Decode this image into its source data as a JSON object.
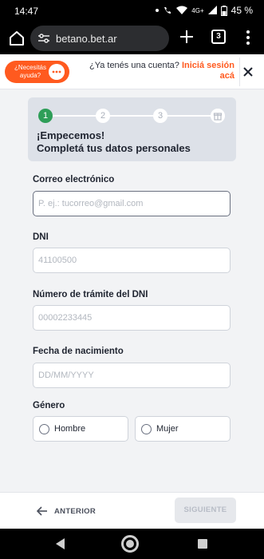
{
  "status_bar": {
    "time": "14:47",
    "network": "4G+",
    "battery": "45 %",
    "icons": [
      "notification-dot-icon",
      "call-wifi-icon",
      "wifi-icon",
      "signal-icon",
      "battery-icon"
    ]
  },
  "browser": {
    "url": "betano.bet.ar",
    "tab_count": "3",
    "icons": [
      "home-icon",
      "site-settings-icon",
      "plus-icon",
      "tabs-icon",
      "overflow-menu-icon"
    ]
  },
  "header": {
    "help_label": "¿Necesitás ayuda?",
    "account_question": "¿Ya tenés una cuenta?",
    "login_link": "Iniciá sesión acá"
  },
  "stepper": {
    "steps": [
      "1",
      "2",
      "3"
    ],
    "current_step": 1,
    "title_line1": "¡Empecemos!",
    "title_line2": "Completá tus datos personales"
  },
  "form": {
    "email": {
      "label": "Correo electrónico",
      "placeholder": "P. ej.: tucorreo@gmail.com",
      "value": ""
    },
    "dni": {
      "label": "DNI",
      "placeholder": "41100500",
      "value": ""
    },
    "tramite": {
      "label": "Número de trámite del DNI",
      "placeholder": "00002233445",
      "value": ""
    },
    "birthdate": {
      "label": "Fecha de nacimiento",
      "placeholder": "DD/MM/YYYY",
      "value": ""
    },
    "gender": {
      "label": "Género",
      "options": [
        "Hombre",
        "Mujer"
      ]
    }
  },
  "footer": {
    "back_label": "ANTERIOR",
    "next_label": "SIGUIENTE"
  },
  "colors": {
    "accent": "#ff5a1f",
    "step_active": "#2e9e58",
    "stepper_bg": "#dde1e8"
  }
}
